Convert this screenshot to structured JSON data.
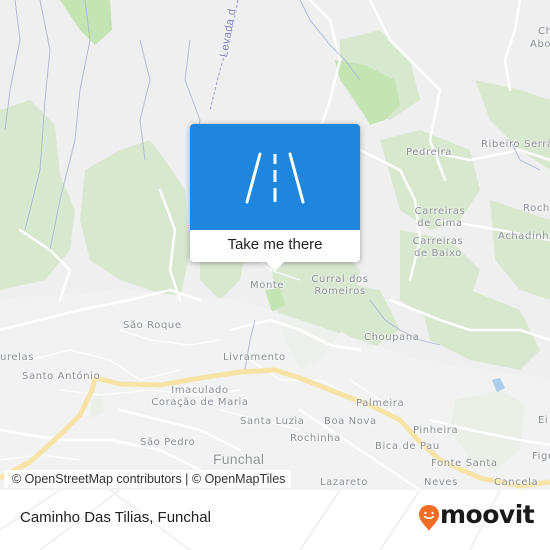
{
  "map": {
    "labels": {
      "levada": "Levada d",
      "ch": "Ch",
      "abo": "Abo",
      "pedreira": "Pedreira",
      "ribeiro_serra": "Ribeiro Serrã",
      "roch": "Roch",
      "carreiras_de_cima_1": "Carreiras",
      "carreiras_de_cima_2": "de Cima",
      "carreiras_de_baixo_1": "Carreiras",
      "carreiras_de_baixo_2": "de Baixo",
      "achadinha": "Achadinha",
      "monte": "Monte",
      "curral_1": "Curral dos",
      "curral_2": "Romeiros",
      "sao_roque": "São Roque",
      "choupana": "Choupana",
      "urelas": "urelas",
      "santo_antonio": "Santo António",
      "livramento": "Livramento",
      "imaculado_1": "Imaculado",
      "imaculado_2": "Coração de Maria",
      "palmeira": "Palmeira",
      "santa_luzia": "Santa Luzia",
      "boa_nova": "Boa Nova",
      "pinheira": "Pinheira",
      "ei": "Ei",
      "rochinha": "Rochinha",
      "sao_pedro": "São Pedro",
      "bica_de_pau": "Bica de Pau",
      "figu": "Figu",
      "funchal": "Funchal",
      "fonte_santa": "Fonte Santa",
      "lazareto": "Lazareto",
      "neves": "Neves",
      "cancela": "Cancela"
    },
    "attribution": "© OpenStreetMap contributors | © OpenMapTiles"
  },
  "popup": {
    "icon": "road-icon",
    "cta_label": "Take me there",
    "color": "#1e86dc"
  },
  "footer": {
    "place_name": "Caminho Das Tilias, Funchal",
    "brand_name": "moovit",
    "brand_color": "#f26c23"
  }
}
